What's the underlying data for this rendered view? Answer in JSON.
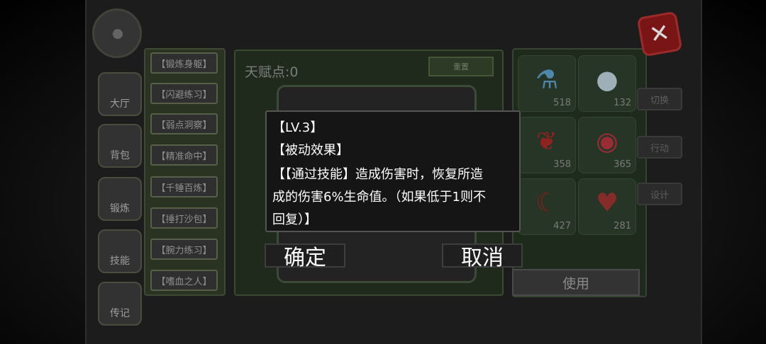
{
  "sidebar": {
    "items": [
      {
        "label": "大厅",
        "icon": "door-icon"
      },
      {
        "label": "背包",
        "icon": "bag-icon"
      },
      {
        "label": "锻炼",
        "icon": "hammer-icon"
      },
      {
        "label": "技能",
        "icon": "gamepad-icon"
      },
      {
        "label": "传记",
        "icon": "book-icon"
      }
    ]
  },
  "skills": [
    "【锻炼身躯】",
    "【闪避练习】",
    "【弱点洞察】",
    "【精准命中】",
    "【千锤百炼】",
    "【捶打沙包】",
    "【腕力练习】",
    "【嗜血之人】"
  ],
  "talent": {
    "label": "天赋点:0",
    "reset_label": "重置"
  },
  "inventory": {
    "items": [
      {
        "icon": "potion-icon",
        "count": "518"
      },
      {
        "icon": "slime-icon",
        "count": "132"
      },
      {
        "icon": "berry-icon",
        "count": "358"
      },
      {
        "icon": "orb-icon",
        "count": "365"
      },
      {
        "icon": "claw-icon",
        "count": "427"
      },
      {
        "icon": "heart-icon",
        "count": "281"
      }
    ],
    "use_label": "使用"
  },
  "right_tabs": [
    "切换",
    "行动",
    "设计"
  ],
  "dialog": {
    "level": "【LV.3】",
    "type": "【被动效果】",
    "desc_line1": "【【通过技能】造成伤害时，恢复所造",
    "desc_line2": "成的伤害6%生命值。（如果低于1则不",
    "desc_line3": "回复）】",
    "confirm_label": "确定",
    "cancel_label": "取消"
  },
  "colors": {
    "dialog_bg": "#151515",
    "close_red": "#7a1515"
  }
}
